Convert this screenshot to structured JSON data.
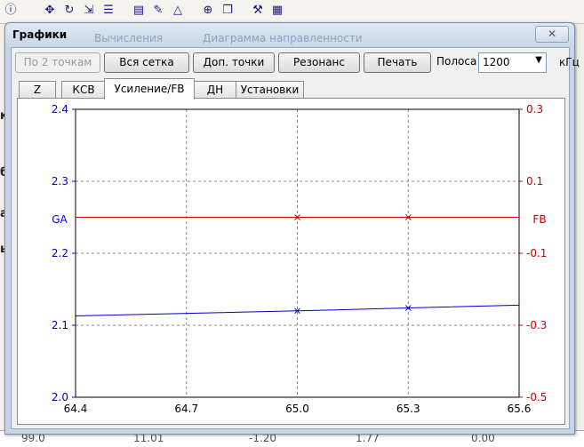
{
  "window": {
    "title": "Графики",
    "background_tabs": [
      "Вычисления",
      "Диаграмма направленности"
    ],
    "close_glyph": "✕"
  },
  "toolbar": {
    "buttons": [
      {
        "label": "По 2 точкам",
        "enabled": false
      },
      {
        "label": "Вся сетка",
        "enabled": true
      },
      {
        "label": "Доп. точки",
        "enabled": true
      },
      {
        "label": "Резонанс",
        "enabled": true
      },
      {
        "label": "Печать",
        "enabled": true
      }
    ],
    "band_label": "Полоса",
    "band_value": "1200",
    "band_unit": "кГц"
  },
  "tabs": [
    {
      "label": "Z",
      "active": false
    },
    {
      "label": "КСВ",
      "active": false
    },
    {
      "label": "Усиление/FB",
      "active": true
    },
    {
      "label": "ДН",
      "active": false
    },
    {
      "label": "Установки",
      "active": false
    }
  ],
  "chart_data": {
    "type": "line",
    "x": [
      64.4,
      65.0,
      65.3,
      65.6
    ],
    "x_ticks": [
      "64.4",
      "64.7",
      "65.0",
      "65.3",
      "65.6"
    ],
    "xlim": [
      64.4,
      65.6
    ],
    "grid": true,
    "left_axis": {
      "label": "GA",
      "ticks": [
        "2.4",
        "2.3",
        "2.2",
        "2.1",
        "2.0"
      ],
      "ylim": [
        2.0,
        2.4
      ],
      "color": "#0000cc"
    },
    "right_axis": {
      "label": "FB",
      "ticks": [
        "0.3",
        "0.1",
        "-0.1",
        "-0.3",
        "-0.5"
      ],
      "ylim": [
        -0.5,
        0.3
      ],
      "color": "#cc0000"
    },
    "series": [
      {
        "axis": "left",
        "color": "#0000cc",
        "x": [
          64.4,
          65.0,
          65.3,
          65.6
        ],
        "values": [
          2.113,
          2.12,
          2.124,
          2.128
        ],
        "markers_at": [
          65.0,
          65.3
        ]
      },
      {
        "axis": "right",
        "color": "#cc0000",
        "x": [
          64.4,
          65.0,
          65.3,
          65.6
        ],
        "values": [
          0.0,
          0.0,
          0.0,
          0.0
        ],
        "markers_at": [
          65.0,
          65.3
        ]
      }
    ]
  },
  "background_app": {
    "fragments": [
      "ка",
      "бо",
      "ал",
      "ы:"
    ],
    "bottom_cells": [
      "99.0",
      "11.01",
      "-1.20",
      "1.77",
      "0.00"
    ]
  }
}
